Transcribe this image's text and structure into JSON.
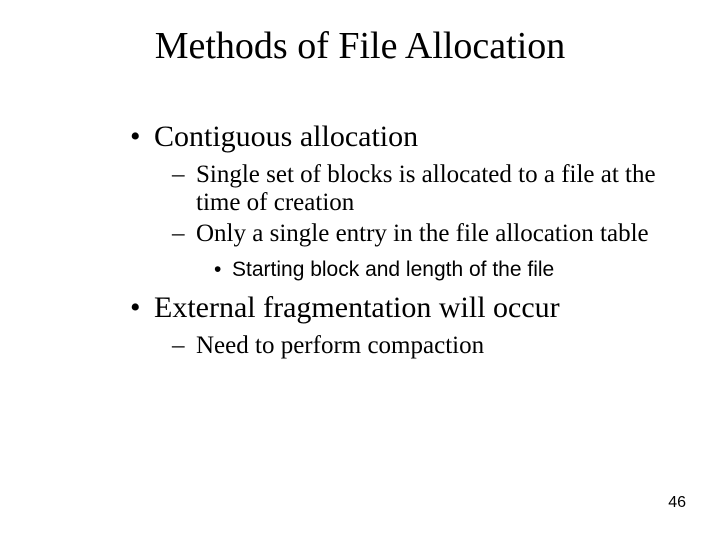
{
  "slide": {
    "title": "Methods of File Allocation",
    "page_number": "46",
    "bullets": [
      {
        "text": "Contiguous allocation",
        "sub": [
          {
            "text": "Single set of blocks is allocated to a file at the time of creation"
          },
          {
            "text": "Only a single entry in the file allocation table",
            "subsub": [
              {
                "text": "Starting block and length of the file"
              }
            ]
          }
        ]
      },
      {
        "text": "External fragmentation will occur",
        "sub": [
          {
            "text": "Need to perform compaction"
          }
        ]
      }
    ]
  }
}
